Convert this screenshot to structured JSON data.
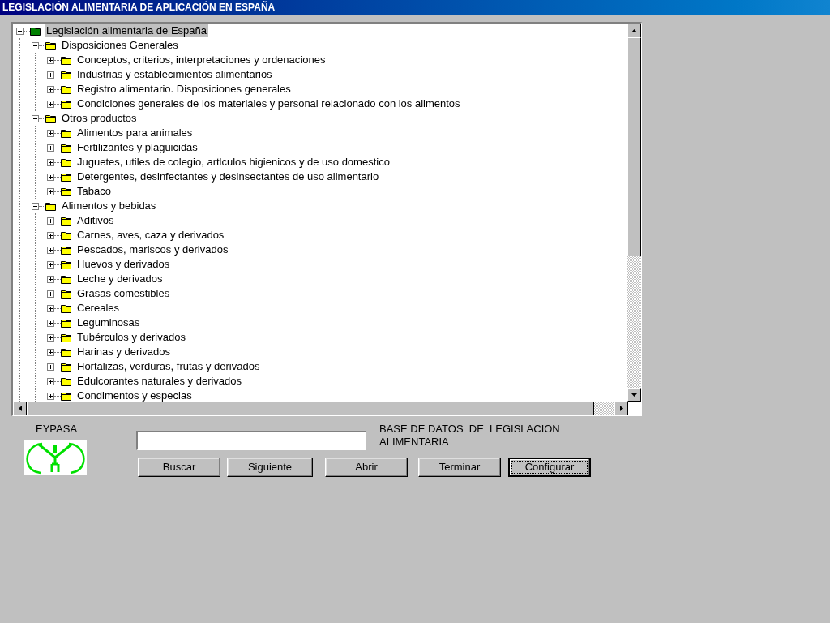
{
  "window": {
    "title": "LEGISLACIÓN ALIMENTARIA DE APLICACIÓN EN ESPAÑA"
  },
  "tree": {
    "label": "Legislación alimentaria de España",
    "expanded": true,
    "selected": true,
    "children": [
      {
        "label": "Disposiciones Generales",
        "expanded": true,
        "selected": false,
        "children": [
          {
            "label": "Conceptos, criterios, interpretaciones y ordenaciones",
            "expanded": false,
            "selected": false
          },
          {
            "label": "Industrias y establecimientos alimentarios",
            "expanded": false,
            "selected": false
          },
          {
            "label": "Registro alimentario. Disposiciones generales",
            "expanded": false,
            "selected": false
          },
          {
            "label": "Condiciones generales de los materiales y personal relacionado con los alimentos",
            "expanded": false,
            "selected": false
          }
        ]
      },
      {
        "label": "Otros productos",
        "expanded": true,
        "selected": false,
        "children": [
          {
            "label": "Alimentos para animales",
            "expanded": false,
            "selected": false
          },
          {
            "label": "Fertilizantes y plaguicidas",
            "expanded": false,
            "selected": false
          },
          {
            "label": "Juguetes, utiles de colegio, artlculos higienicos y de uso domestico",
            "expanded": false,
            "selected": false
          },
          {
            "label": "Detergentes, desinfectantes y desinsectantes de uso alimentario",
            "expanded": false,
            "selected": false
          },
          {
            "label": "Tabaco",
            "expanded": false,
            "selected": false
          }
        ]
      },
      {
        "label": "Alimentos y bebidas",
        "expanded": true,
        "selected": false,
        "children": [
          {
            "label": "Aditivos",
            "expanded": false,
            "selected": false
          },
          {
            "label": "Carnes, aves, caza y derivados",
            "expanded": false,
            "selected": false
          },
          {
            "label": "Pescados, mariscos y derivados",
            "expanded": false,
            "selected": false
          },
          {
            "label": "Huevos y derivados",
            "expanded": false,
            "selected": false
          },
          {
            "label": "Leche y derivados",
            "expanded": false,
            "selected": false
          },
          {
            "label": "Grasas comestibles",
            "expanded": false,
            "selected": false
          },
          {
            "label": "Cereales",
            "expanded": false,
            "selected": false
          },
          {
            "label": "Leguminosas",
            "expanded": false,
            "selected": false
          },
          {
            "label": "Tubérculos y derivados",
            "expanded": false,
            "selected": false
          },
          {
            "label": "Harinas y derivados",
            "expanded": false,
            "selected": false
          },
          {
            "label": "Hortalizas, verduras, frutas y derivados",
            "expanded": false,
            "selected": false
          },
          {
            "label": "Edulcorantes naturales y derivados",
            "expanded": false,
            "selected": false
          },
          {
            "label": "Condimentos y especias",
            "expanded": false,
            "selected": false
          }
        ]
      }
    ]
  },
  "logo": {
    "label": "EYPASA"
  },
  "caption": "BASE DE DATOS  DE  LEGISLACION ALIMENTARIA",
  "buttons": [
    {
      "label": "Buscar",
      "focused": false
    },
    {
      "label": "Siguiente",
      "focused": false
    },
    {
      "label": "Abrir",
      "focused": false
    },
    {
      "label": "Terminar",
      "focused": false
    },
    {
      "label": "Configurar",
      "focused": true
    }
  ]
}
